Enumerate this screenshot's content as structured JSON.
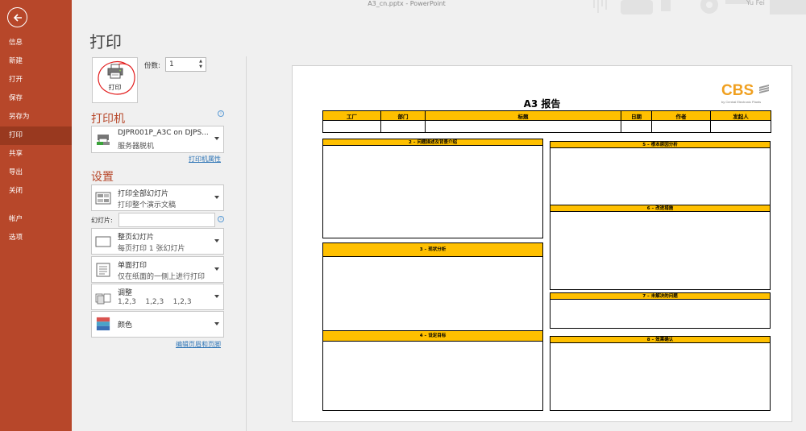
{
  "titlebar": {
    "text": "A3_cn.pptx - PowerPoint",
    "user": "Yu Fei"
  },
  "sidebar": {
    "items": [
      {
        "label": "信息"
      },
      {
        "label": "新建"
      },
      {
        "label": "打开"
      },
      {
        "label": "保存"
      },
      {
        "label": "另存为"
      },
      {
        "label": "打印",
        "active": true
      },
      {
        "label": "共享"
      },
      {
        "label": "导出"
      },
      {
        "label": "关闭"
      }
    ],
    "items_bottom": [
      {
        "label": "帐户"
      },
      {
        "label": "选项"
      }
    ]
  },
  "print": {
    "page_title": "打印",
    "button_label": "打印",
    "copies_label": "份数:",
    "copies_value": "1"
  },
  "printer": {
    "section_title": "打印机",
    "name": "DJPR001P_A3C on DJPS...",
    "status": "服务器脱机",
    "properties_link": "打印机属性"
  },
  "settings": {
    "section_title": "设置",
    "range": {
      "title": "打印全部幻灯片",
      "subtitle": "打印整个演示文稿"
    },
    "slides_label": "幻灯片:",
    "slides_value": "",
    "layout": {
      "title": "整页幻灯片",
      "subtitle": "每页打印 1 张幻灯片"
    },
    "sides": {
      "title": "单面打印",
      "subtitle": "仅在纸面的一侧上进行打印"
    },
    "collate": {
      "title": "调整",
      "subtitle": "1,2,3    1,2,3    1,2,3"
    },
    "color": {
      "title": "颜色"
    },
    "header_footer_link": "编辑页眉和页脚"
  },
  "preview": {
    "logo_text": "CBS",
    "logo_subtext": "by Central Electronic Plants",
    "report_title": "A3 报告",
    "table_headers": [
      "工厂",
      "部门",
      "标题",
      "日期",
      "作者",
      "发起人"
    ],
    "sections": {
      "s2": "2 – 问题描述及背景介绍",
      "s3": "3 – 现状分析",
      "s4": "4 – 设定目标",
      "s5": "5 – 根本原因分析",
      "s6": "6 – 改进措施",
      "s7": "7 – 未解决的问题",
      "s8": "8 – 效果确认"
    }
  },
  "colors": {
    "sidebar": "#b7472a",
    "sidebar_active": "#99391f",
    "accent_text": "#b7472a",
    "header_fill": "#ffc000",
    "link": "#2e75b6"
  }
}
